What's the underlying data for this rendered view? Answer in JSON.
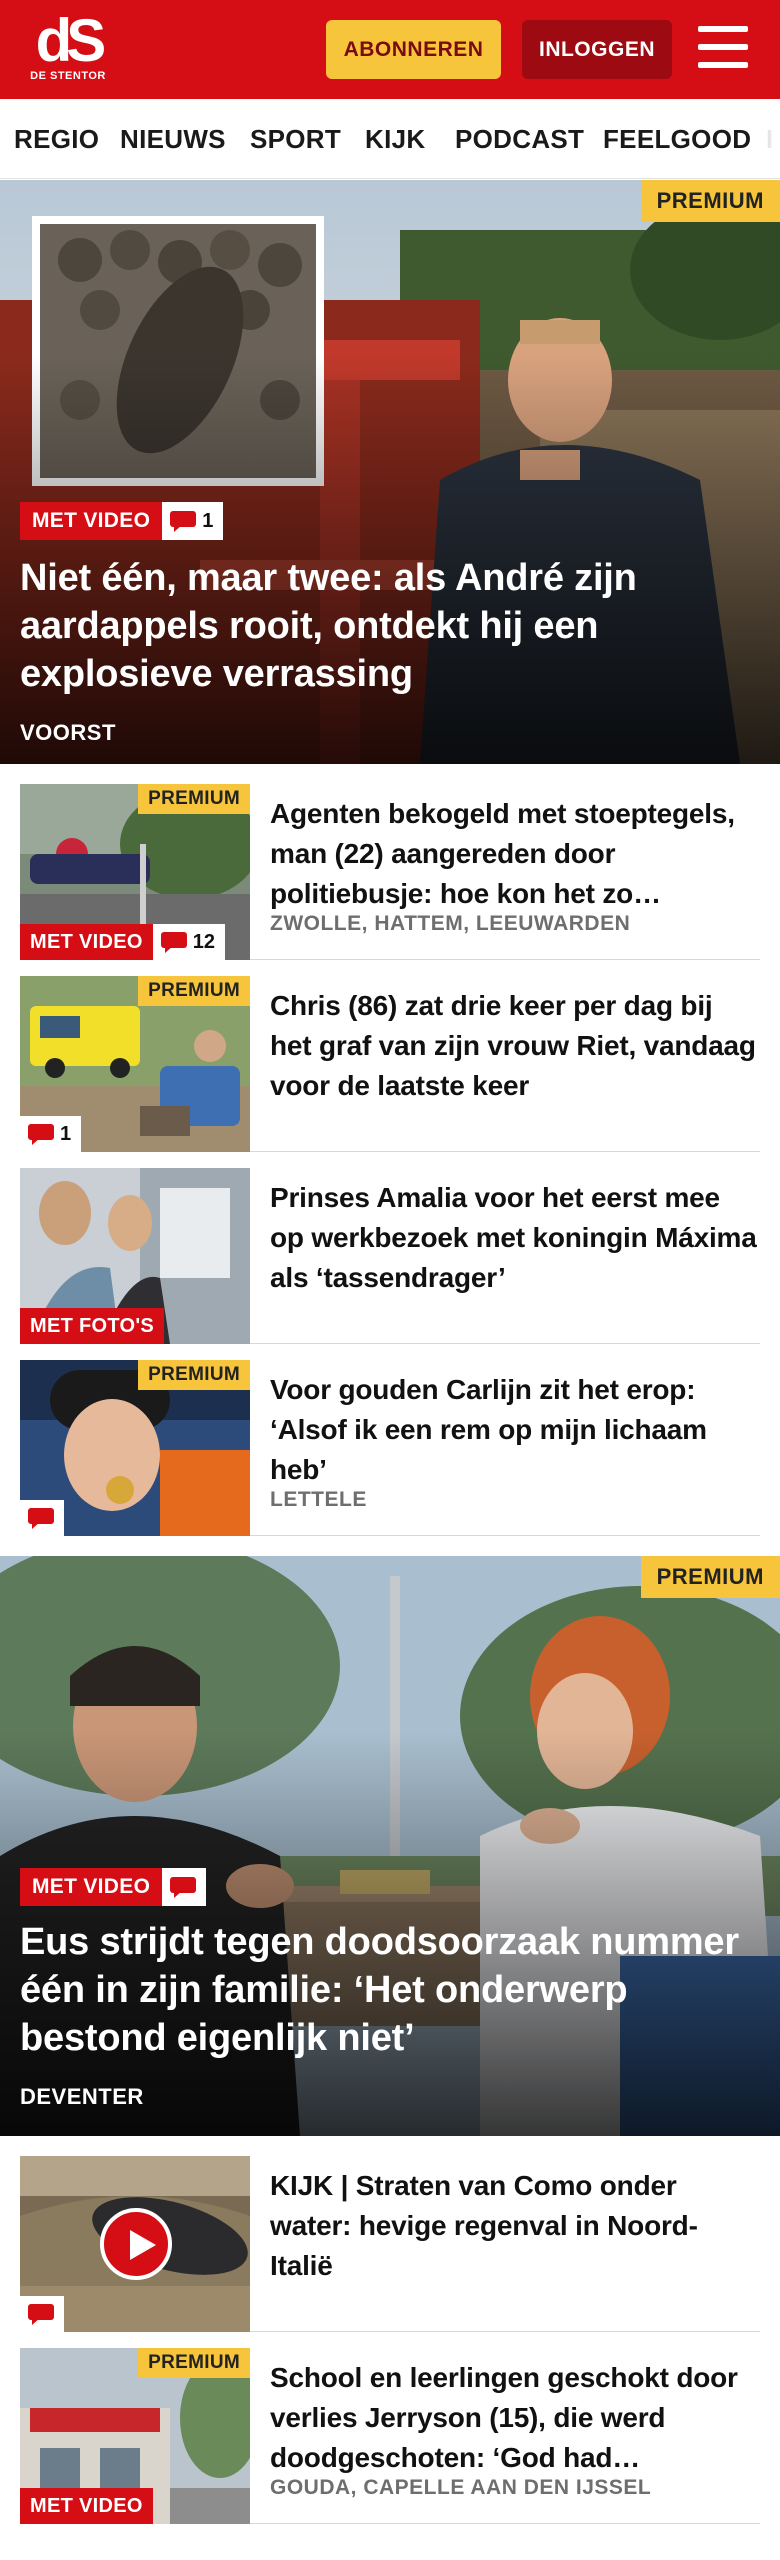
{
  "header": {
    "logo_mark": "dS",
    "logo_sub": "DE STENTOR",
    "subscribe_label": "ABONNEREN",
    "login_label": "INLOGGEN"
  },
  "nav": {
    "items": [
      "REGIO",
      "NIEUWS",
      "SPORT",
      "KIJK",
      "PODCAST",
      "FEELGOOD"
    ]
  },
  "hero1": {
    "premium": "PREMIUM",
    "tag": "MET VIDEO",
    "comments": "1",
    "title": "Niet één, maar twee: als André zijn aardappels rooit, ontdekt hij een explosieve verrassing",
    "location": "VOORST"
  },
  "list1": [
    {
      "premium": "PREMIUM",
      "tag": "MET VIDEO",
      "comments": "12",
      "title": "Agenten bekogeld met stoeptegels, man (22) aangereden door politiebusje: hoe kon het zo…",
      "location": "ZWOLLE, HATTEM, LEEUWARDEN"
    },
    {
      "premium": "PREMIUM",
      "comments": "1",
      "title": "Chris (86) zat drie keer per dag bij het graf van zijn vrouw Riet, vandaag voor de laatste keer"
    },
    {
      "tag": "MET FOTO'S",
      "title": "Prinses Amalia voor het eerst mee op werkbezoek met koningin Máxima als ‘tassendrager’"
    },
    {
      "premium": "PREMIUM",
      "title": "Voor gouden Carlijn zit het erop: ‘Alsof ik een rem op mijn lichaam heb’",
      "location": "LETTELE"
    }
  ],
  "hero2": {
    "premium": "PREMIUM",
    "tag": "MET VIDEO",
    "title": "Eus strijdt tegen doodsoorzaak nummer één in zijn familie: ‘Het onderwerp bestond eigenlijk niet’",
    "location": "DEVENTER"
  },
  "list2": [
    {
      "title": "KIJK | Straten van Como onder water: hevige regenval in Noord-Italië"
    },
    {
      "premium": "PREMIUM",
      "tag": "MET VIDEO",
      "title": "School en leerlingen geschokt door verlies Jerryson (15), die werd doodgeschoten: ‘God had…",
      "location": "GOUDA, CAPELLE AAN DEN IJSSEL"
    }
  ],
  "colors": {
    "brand_red": "#d50d15",
    "dark_red": "#9d0a12",
    "premium_yellow": "#f6c53c"
  }
}
